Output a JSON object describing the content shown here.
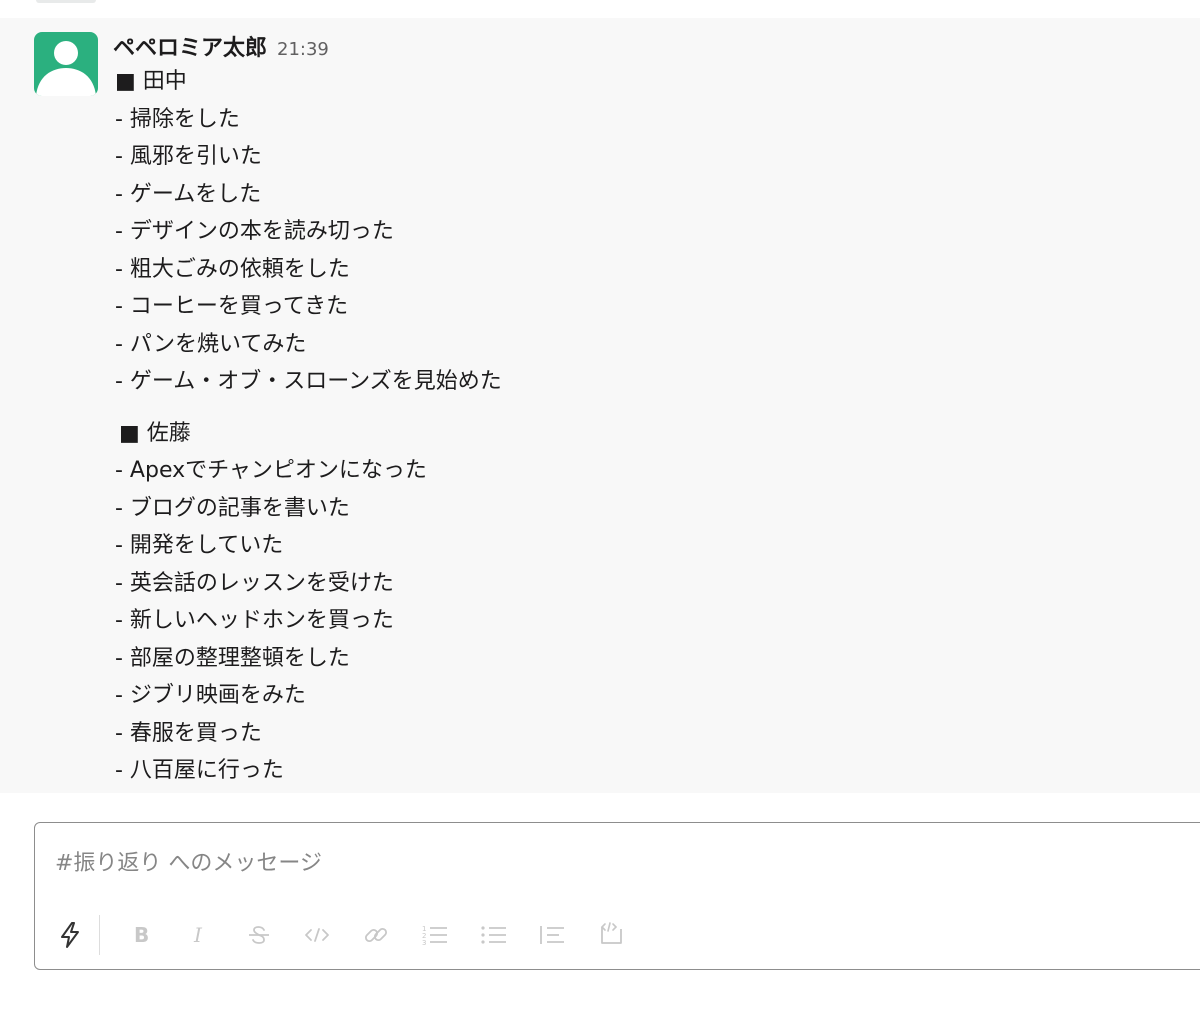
{
  "message": {
    "sender": "ペペロミア太郎",
    "timestamp": "21:39",
    "sections": [
      {
        "heading": "■ 田中",
        "items": [
          "- 掃除をした",
          "- 風邪を引いた",
          "- ゲームをした",
          "- デザインの本を読み切った",
          "- 粗大ごみの依頼をした",
          "- コーヒーを買ってきた",
          "- パンを焼いてみた",
          "- ゲーム・オブ・スローンズを見始めた"
        ]
      },
      {
        "heading": "■ 佐藤",
        "items": [
          "- Apexでチャンピオンになった",
          "- ブログの記事を書いた",
          "- 開発をしていた",
          "- 英会話のレッスンを受けた",
          "- 新しいヘッドホンを買った",
          "- 部屋の整理整頓をした",
          "- ジブリ映画をみた",
          "- 春服を買った",
          "- 八百屋に行った"
        ]
      }
    ]
  },
  "composer": {
    "placeholder": "#振り返り へのメッセージ",
    "toolbar": [
      {
        "icon": "shortcuts-lightning-icon",
        "label": "shortcuts"
      },
      {
        "icon": "bold-icon",
        "label": "B"
      },
      {
        "icon": "italic-icon",
        "label": "I"
      },
      {
        "icon": "strikethrough-icon",
        "label": "S"
      },
      {
        "icon": "code-icon",
        "label": "</>"
      },
      {
        "icon": "link-icon",
        "label": "link"
      },
      {
        "icon": "ordered-list-icon",
        "label": "ordered list"
      },
      {
        "icon": "bulleted-list-icon",
        "label": "bulleted list"
      },
      {
        "icon": "blockquote-icon",
        "label": "quote"
      },
      {
        "icon": "code-block-icon",
        "label": "code block"
      }
    ]
  },
  "colors": {
    "avatar": "#2bb07f",
    "message_bg": "#f8f8f8",
    "toolbar_icon": "#c8c8c8"
  }
}
